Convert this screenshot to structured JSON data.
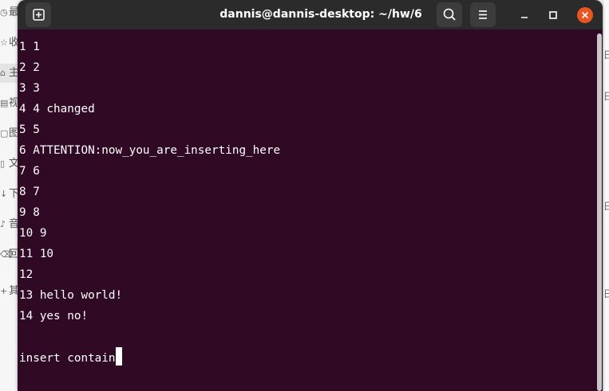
{
  "window": {
    "title": "dannis@dannis-desktop: ~/hw/6",
    "icons": {
      "new_tab": "new-tab-icon",
      "search": "search-icon",
      "menu": "hamburger-menu-icon",
      "minimize": "minimize-icon",
      "maximize": "maximize-icon",
      "close": "close-icon"
    },
    "colors": {
      "terminal_bg": "#300a24",
      "titlebar_bg": "#2b2b2b",
      "close_button": "#e95420",
      "text": "#ffffff"
    }
  },
  "terminal": {
    "lines": [
      "1 1",
      "2 2",
      "3 3",
      "4 4 changed",
      "5 5",
      "6 ATTENTION:now_you_are_inserting_here",
      "7 6",
      "8 7",
      "9 8",
      "10 9",
      "11 10",
      "12",
      "13 hello world!",
      "14 yes no!",
      "",
      "insert contain"
    ]
  },
  "background_app": {
    "sidebar_glyphs": [
      "最",
      "收",
      "主",
      "视",
      "图",
      "文",
      "下",
      "音",
      "回",
      "其"
    ]
  }
}
